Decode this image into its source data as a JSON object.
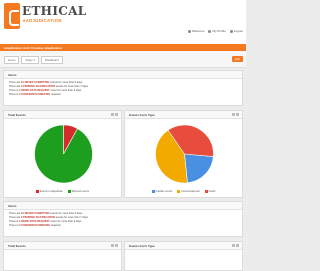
{
  "brand": {
    "name": "ETHICAL",
    "tagline": "eADJUDICATION",
    "accent": "#f47920"
  },
  "toplinks": [
    "Welcome",
    "My Profile",
    "Logout"
  ],
  "orange_bar_text": "Adjudication Unit / Pending Adjudication",
  "breadcrumbs": [
    "Home",
    "Study 1",
    "Dashboard"
  ],
  "edit_button": "Edit",
  "alerts_panel": {
    "title": "Alerts",
    "lines": [
      {
        "pre": "There are",
        "bold": "10 NEVER SUBMITTED",
        "post": "events for more than 5 days"
      },
      {
        "pre": "There are",
        "bold": "5 PENDING ADJUDICATION",
        "post": "events for more than 7 days"
      },
      {
        "pre": "There is",
        "bold": "1 MORE DATA REQUEST",
        "post": "event for more than 9 days"
      },
      {
        "pre": "There is",
        "bold": "2 CONSENSUS MEETING",
        "post": "required"
      }
    ]
  },
  "alerts_panel_2": {
    "title": "Alerts",
    "lines": [
      {
        "pre": "There are",
        "bold": "10 NEVER SUBMITTED",
        "post": "events for more than 5 days"
      },
      {
        "pre": "There are",
        "bold": "5 PENDING ADJUDICATION",
        "post": "events for more than 7 days"
      },
      {
        "pre": "There is",
        "bold": "1 MORE DATA REQUEST",
        "post": "event for more than 9 days"
      },
      {
        "pre": "There is",
        "bold": "2 CONSENSUS MEETING",
        "post": "required"
      }
    ]
  },
  "total_events": {
    "title": "Total Events",
    "legend": [
      {
        "label": "Events to Adjudicate",
        "color": "#d62b2b"
      },
      {
        "label": "Planned events",
        "color": "#1e9e1e"
      }
    ]
  },
  "events_type": {
    "title": "Events Form Type",
    "legend": [
      {
        "label": "Cardiac events",
        "color": "#4a90e2"
      },
      {
        "label": "Cerebrovascular",
        "color": "#f2a900"
      },
      {
        "label": "Death",
        "color": "#e74c3c"
      }
    ]
  },
  "bottom_left_title": "Total Events",
  "bottom_right_title": "Events Form Type",
  "chart_data": [
    {
      "type": "pie",
      "title": "Total Events",
      "categories": [
        "Events to Adjudicate",
        "Planned events"
      ],
      "values": [
        8,
        92
      ],
      "colors": [
        "#d62b2b",
        "#1e9e1e"
      ]
    },
    {
      "type": "pie",
      "title": "Events Form Type",
      "categories": [
        "Cardiac events",
        "Cerebrovascular",
        "Death"
      ],
      "values": [
        22,
        42,
        36
      ],
      "colors": [
        "#4a90e2",
        "#f2a900",
        "#e74c3c"
      ]
    }
  ]
}
